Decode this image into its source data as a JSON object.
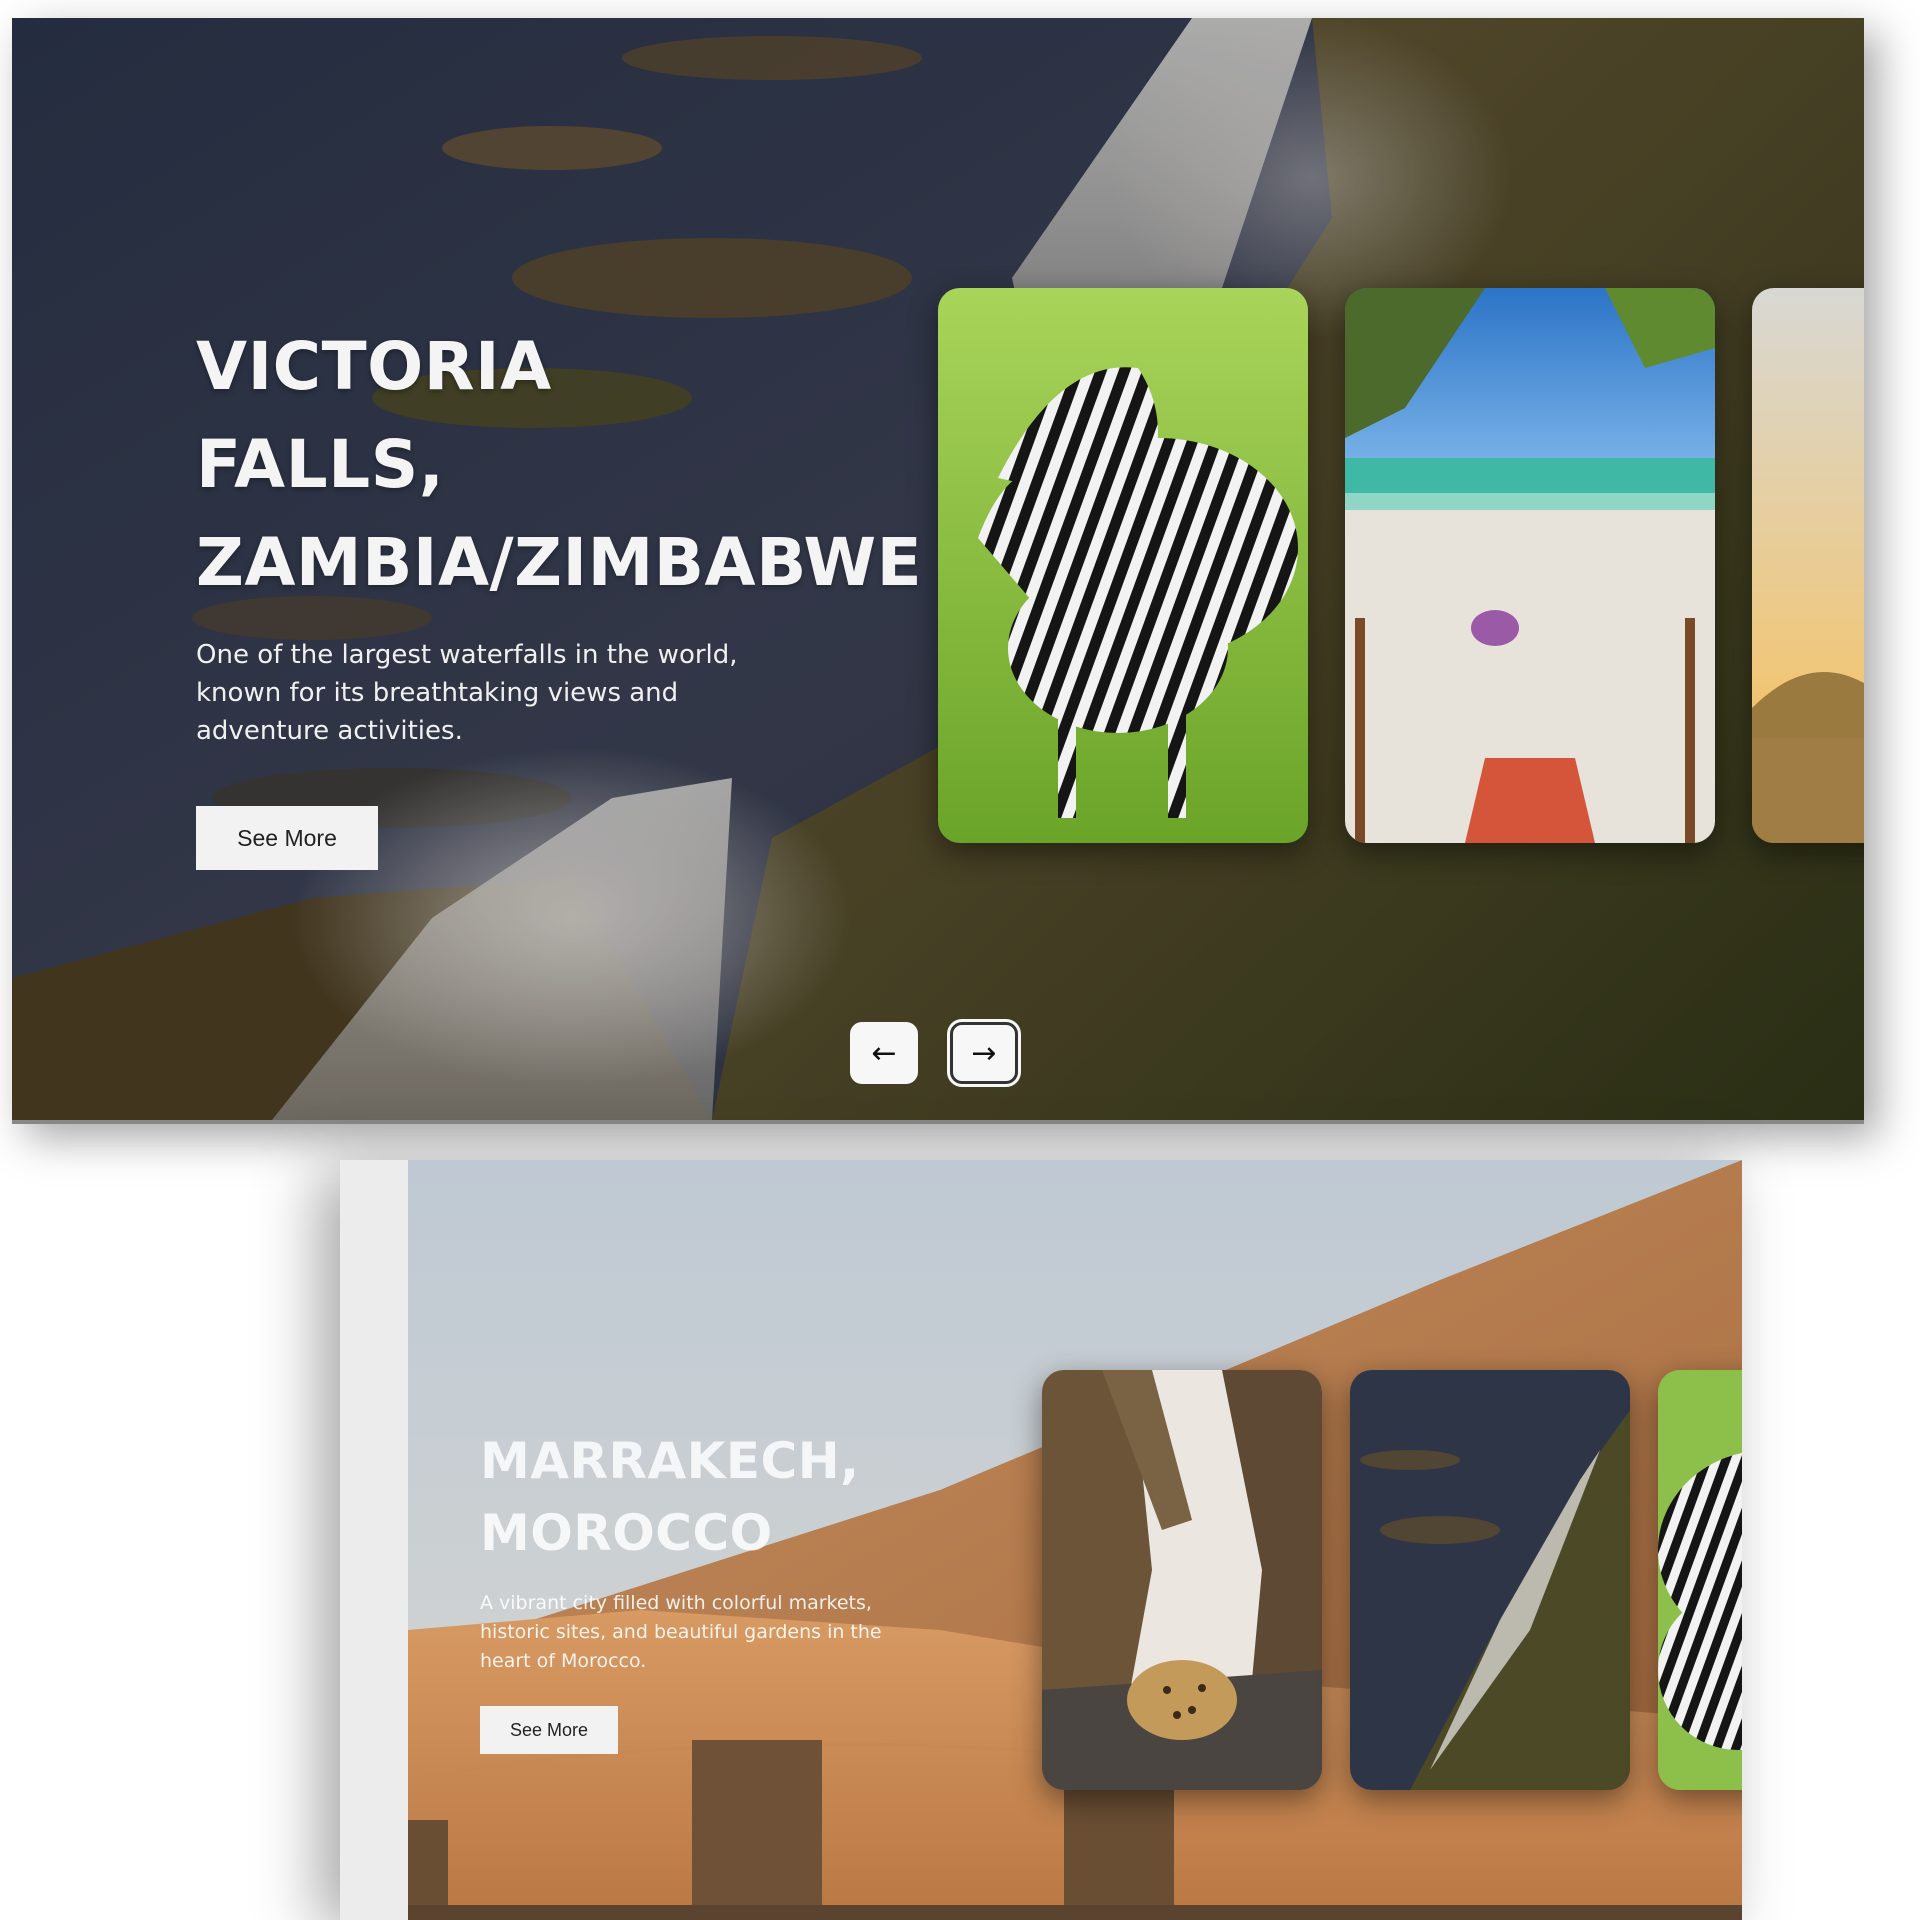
{
  "slides": [
    {
      "title_lines": [
        "VICTORIA",
        "FALLS,",
        "ZAMBIA/ZIMBABWE"
      ],
      "description": "One of the largest waterfalls in the world, known for its breathtaking views and adventure activities.",
      "button_label": "See More",
      "thumbnails": [
        "zebras",
        "tropical-beach",
        "sphinx-desert"
      ]
    },
    {
      "title_lines": [
        "MARRAKECH,",
        "MOROCCO"
      ],
      "description": "A vibrant city filled with colorful markets, historic sites, and beautiful gardens in the heart of Morocco.",
      "button_label": "See More",
      "thumbnails": [
        "leopard-in-tree",
        "victoria-falls",
        "zebras"
      ]
    }
  ],
  "navigation": {
    "prev_icon": "arrow-left-icon",
    "next_icon": "arrow-right-icon",
    "prev_glyph": "←",
    "next_glyph": "→"
  }
}
